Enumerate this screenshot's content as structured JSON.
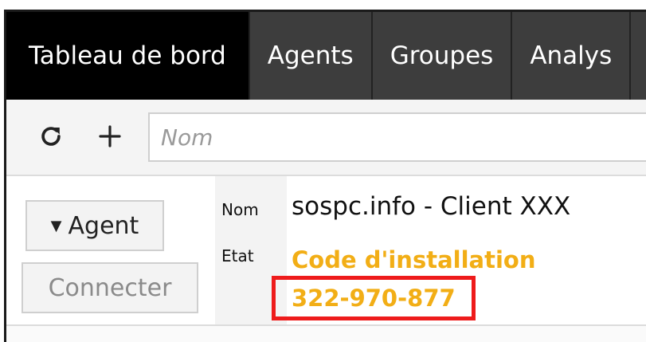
{
  "tabs": [
    {
      "label": "Tableau de bord",
      "active": true
    },
    {
      "label": "Agents",
      "active": false
    },
    {
      "label": "Groupes",
      "active": false
    },
    {
      "label": "Analys",
      "active": false
    }
  ],
  "toolbar": {
    "refresh_icon": "refresh-icon",
    "add_icon": "plus-icon",
    "search_placeholder": "Nom"
  },
  "agent": {
    "dropdown_label": "Agent",
    "connect_label": "Connecter",
    "name_label": "Nom",
    "name_value": "sospc.info - Client XXX",
    "state_label": "Etat",
    "state_value": "Code d'installation",
    "install_code": "322-970-877"
  },
  "colors": {
    "tab_active_bg": "#000000",
    "tab_bg": "#3d3d3d",
    "status": "#f2ae16",
    "highlight": "#ee1b1b"
  }
}
